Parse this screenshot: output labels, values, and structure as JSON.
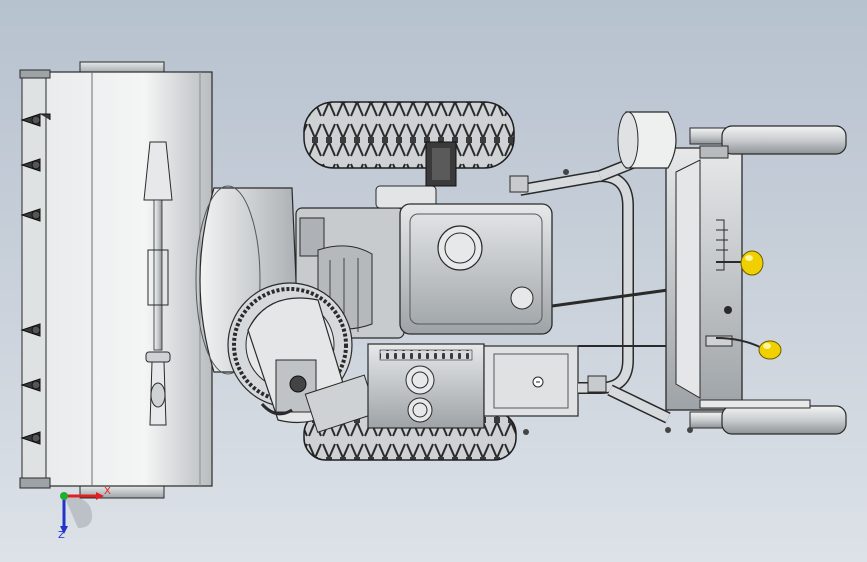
{
  "triad": {
    "x_label": "X",
    "z_label": "Z",
    "x_color": "#e02020",
    "y_color": "#1fae2f",
    "z_color": "#2233cc"
  },
  "model": {
    "body_color": "#d4d7d9",
    "edge_color": "#2a2a2a",
    "knob_color": "#f0d000"
  }
}
